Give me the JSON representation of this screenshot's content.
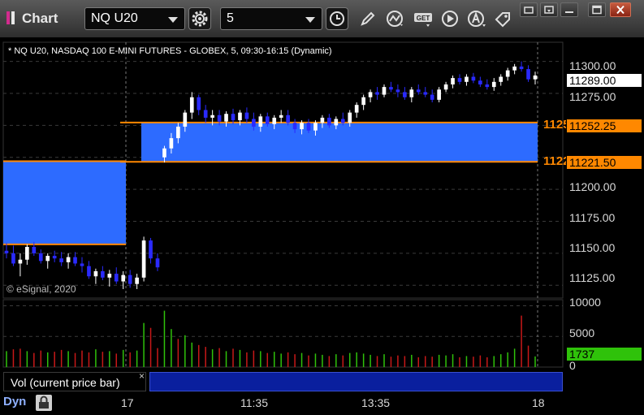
{
  "titlebar": {
    "title": "Chart",
    "symbol": "NQ U20",
    "interval": "5",
    "buttons": [
      "gear-icon",
      "clock-icon",
      "pencil-icon",
      "study-icon",
      "get-icon",
      "play-icon",
      "alert-icon",
      "tag-icon"
    ],
    "window_buttons": [
      "restore-icon",
      "dock-icon",
      "maximize-icon",
      "close-icon"
    ]
  },
  "legend": "* NQ U20, NASDAQ 100 E-MINI FUTURES - GLOBEX, 5, 09:30-16:15 (Dynamic)",
  "copyright": "© eSignal, 2020",
  "price_axis": {
    "ticks": [
      "11300.00",
      "11275.00",
      "11200.00",
      "11175.00",
      "11150.00",
      "11125.00"
    ],
    "last_price": "11289.00",
    "level_high": "11252.25",
    "level_low": "11221.50",
    "level_high_short": "11252.25",
    "level_low_short": "11221.50"
  },
  "volume_axis": {
    "ticks": [
      "10000",
      "5000",
      "0"
    ],
    "current_volume": "1737"
  },
  "study": {
    "label": "Vol (current price bar)",
    "close": "×"
  },
  "x_axis": {
    "ticks": [
      "17",
      "11:35",
      "13:35",
      "18"
    ],
    "mode": "Dyn"
  },
  "colors": {
    "up": "#ffffff",
    "down": "#2a2aff",
    "zone": "#2d6bff",
    "zone_border": "#ff8800",
    "vol_up": "#2fc20a",
    "vol_down": "#c81818"
  },
  "chart_data": {
    "type": "candlestick",
    "ylim": [
      11115,
      11315
    ],
    "volume_ylim": [
      0,
      11000
    ],
    "zones": [
      {
        "name": "prior-zone",
        "top": 11222,
        "bottom": 11157
      },
      {
        "name": "current-zone",
        "top": 11252.25,
        "bottom": 11221.5
      }
    ],
    "candles": [
      [
        11152,
        11158,
        11146,
        11150
      ],
      [
        11150,
        11156,
        11140,
        11142
      ],
      [
        11142,
        11150,
        11132,
        11145
      ],
      [
        11145,
        11157,
        11141,
        11155
      ],
      [
        11155,
        11159,
        11148,
        11150
      ],
      [
        11150,
        11153,
        11142,
        11144
      ],
      [
        11144,
        11150,
        11138,
        11148
      ],
      [
        11148,
        11152,
        11143,
        11146
      ],
      [
        11146,
        11151,
        11140,
        11143
      ],
      [
        11143,
        11150,
        11138,
        11147
      ],
      [
        11147,
        11151,
        11140,
        11142
      ],
      [
        11142,
        11147,
        11135,
        11140
      ],
      [
        11140,
        11144,
        11130,
        11132
      ],
      [
        11132,
        11138,
        11126,
        11136
      ],
      [
        11136,
        11140,
        11129,
        11131
      ],
      [
        11131,
        11137,
        11124,
        11134
      ],
      [
        11134,
        11139,
        11126,
        11128
      ],
      [
        11128,
        11136,
        11122,
        11133
      ],
      [
        11133,
        11137,
        11123,
        11126
      ],
      [
        11126,
        11134,
        11122,
        11131
      ],
      [
        11131,
        11163,
        11128,
        11160
      ],
      [
        11160,
        11162,
        11142,
        11146
      ],
      [
        11146,
        11150,
        11136,
        11139
      ],
      [
        11225,
        11234,
        11221,
        11232
      ],
      [
        11232,
        11244,
        11228,
        11240
      ],
      [
        11240,
        11252,
        11236,
        11249
      ],
      [
        11249,
        11262,
        11245,
        11260
      ],
      [
        11260,
        11276,
        11255,
        11272
      ],
      [
        11272,
        11274,
        11258,
        11262
      ],
      [
        11262,
        11266,
        11252,
        11256
      ],
      [
        11256,
        11262,
        11250,
        11258
      ],
      [
        11258,
        11262,
        11250,
        11253
      ],
      [
        11253,
        11261,
        11249,
        11259
      ],
      [
        11259,
        11263,
        11251,
        11254
      ],
      [
        11254,
        11262,
        11250,
        11260
      ],
      [
        11260,
        11264,
        11252,
        11255
      ],
      [
        11255,
        11260,
        11246,
        11249
      ],
      [
        11249,
        11259,
        11245,
        11257
      ],
      [
        11257,
        11260,
        11249,
        11251
      ],
      [
        11251,
        11258,
        11247,
        11256
      ],
      [
        11256,
        11262,
        11252,
        11258
      ],
      [
        11258,
        11262,
        11250,
        11252
      ],
      [
        11252,
        11255,
        11244,
        11247
      ],
      [
        11247,
        11254,
        11243,
        11252
      ],
      [
        11252,
        11255,
        11244,
        11246
      ],
      [
        11246,
        11254,
        11242,
        11252
      ],
      [
        11252,
        11258,
        11248,
        11256
      ],
      [
        11256,
        11259,
        11248,
        11250
      ],
      [
        11250,
        11257,
        11247,
        11255
      ],
      [
        11255,
        11260,
        11250,
        11252
      ],
      [
        11252,
        11262,
        11249,
        11260
      ],
      [
        11260,
        11268,
        11256,
        11266
      ],
      [
        11266,
        11274,
        11262,
        11272
      ],
      [
        11272,
        11278,
        11268,
        11276
      ],
      [
        11276,
        11280,
        11270,
        11274
      ],
      [
        11274,
        11282,
        11272,
        11280
      ],
      [
        11280,
        11284,
        11276,
        11278
      ],
      [
        11278,
        11282,
        11272,
        11276
      ],
      [
        11276,
        11280,
        11270,
        11272
      ],
      [
        11272,
        11280,
        11268,
        11278
      ],
      [
        11278,
        11282,
        11274,
        11276
      ],
      [
        11276,
        11280,
        11272,
        11274
      ],
      [
        11274,
        11278,
        11268,
        11270
      ],
      [
        11270,
        11280,
        11268,
        11278
      ],
      [
        11278,
        11284,
        11276,
        11282
      ],
      [
        11282,
        11289,
        11279,
        11287
      ],
      [
        11287,
        11290,
        11282,
        11284
      ],
      [
        11284,
        11290,
        11281,
        11288
      ],
      [
        11288,
        11291,
        11283,
        11285
      ],
      [
        11285,
        11288,
        11280,
        11282
      ],
      [
        11282,
        11286,
        11278,
        11280
      ],
      [
        11280,
        11287,
        11277,
        11284
      ],
      [
        11284,
        11290,
        11281,
        11288
      ],
      [
        11288,
        11295,
        11285,
        11293
      ],
      [
        11293,
        11298,
        11290,
        11296
      ],
      [
        11296,
        11300,
        11292,
        11294
      ],
      [
        11294,
        11297,
        11284,
        11286
      ],
      [
        11286,
        11292,
        11282,
        11289
      ]
    ],
    "volume": [
      [
        2600,
        1
      ],
      [
        2900,
        0
      ],
      [
        3000,
        0
      ],
      [
        2600,
        1
      ],
      [
        2300,
        0
      ],
      [
        2700,
        0
      ],
      [
        2400,
        1
      ],
      [
        2500,
        0
      ],
      [
        2800,
        0
      ],
      [
        2600,
        1
      ],
      [
        2300,
        0
      ],
      [
        2700,
        0
      ],
      [
        2400,
        0
      ],
      [
        2900,
        1
      ],
      [
        2500,
        0
      ],
      [
        2600,
        1
      ],
      [
        2200,
        0
      ],
      [
        2800,
        1
      ],
      [
        2400,
        0
      ],
      [
        2700,
        1
      ],
      [
        7200,
        1
      ],
      [
        6400,
        0
      ],
      [
        3100,
        0
      ],
      [
        9200,
        1
      ],
      [
        6200,
        1
      ],
      [
        4600,
        0
      ],
      [
        5200,
        1
      ],
      [
        4000,
        1
      ],
      [
        3600,
        0
      ],
      [
        3300,
        0
      ],
      [
        2900,
        1
      ],
      [
        3100,
        0
      ],
      [
        2600,
        1
      ],
      [
        3000,
        0
      ],
      [
        2800,
        1
      ],
      [
        2400,
        0
      ],
      [
        2700,
        0
      ],
      [
        2600,
        1
      ],
      [
        2300,
        0
      ],
      [
        2500,
        1
      ],
      [
        2200,
        1
      ],
      [
        2400,
        0
      ],
      [
        2100,
        0
      ],
      [
        2300,
        1
      ],
      [
        1900,
        0
      ],
      [
        2200,
        1
      ],
      [
        2000,
        1
      ],
      [
        1800,
        0
      ],
      [
        2100,
        1
      ],
      [
        1900,
        0
      ],
      [
        2300,
        1
      ],
      [
        2400,
        1
      ],
      [
        2200,
        1
      ],
      [
        2000,
        1
      ],
      [
        1800,
        0
      ],
      [
        2100,
        1
      ],
      [
        1700,
        0
      ],
      [
        1900,
        0
      ],
      [
        1800,
        0
      ],
      [
        2000,
        1
      ],
      [
        1600,
        0
      ],
      [
        1800,
        0
      ],
      [
        1700,
        0
      ],
      [
        2000,
        1
      ],
      [
        1900,
        1
      ],
      [
        2100,
        1
      ],
      [
        1600,
        0
      ],
      [
        1800,
        1
      ],
      [
        1700,
        0
      ],
      [
        1900,
        0
      ],
      [
        1600,
        0
      ],
      [
        1800,
        1
      ],
      [
        2100,
        1
      ],
      [
        2400,
        1
      ],
      [
        3000,
        1
      ],
      [
        8400,
        0
      ],
      [
        3500,
        0
      ],
      [
        1737,
        1
      ]
    ]
  }
}
